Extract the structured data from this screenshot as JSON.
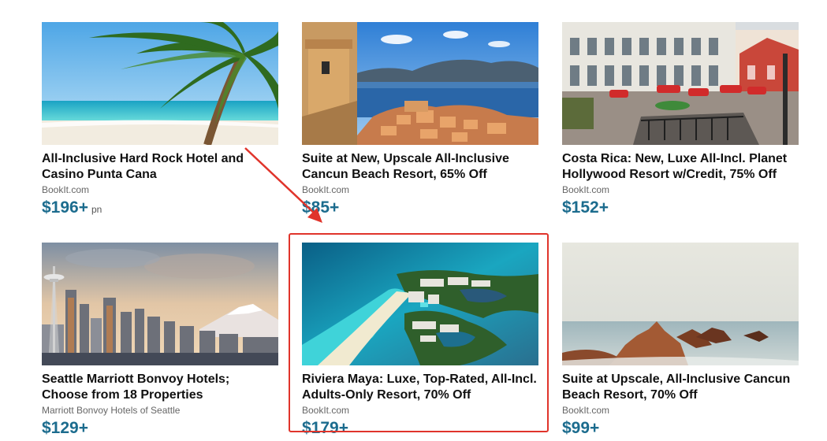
{
  "cards": [
    {
      "title": "All-Inclusive Hard Rock Hotel and Casino Punta Cana",
      "source": "BookIt.com",
      "price": "$196+",
      "unit": "pn",
      "image": "palm-tree-beach"
    },
    {
      "title": "Suite at New, Upscale All-Inclusive Cancun Beach Resort, 65% Off",
      "source": "BookIt.com",
      "price": "$85+",
      "unit": "",
      "image": "coastal-fortress-town"
    },
    {
      "title": "Costa Rica: New, Luxe All-Incl. Planet Hollywood Resort w/Credit, 75% Off",
      "source": "BookIt.com",
      "price": "$152+",
      "unit": "",
      "image": "colonial-plaza"
    },
    {
      "title": "Seattle Marriott Bonvoy Hotels; Choose from 18 Properties",
      "source": "Marriott Bonvoy Hotels of Seattle",
      "price": "$129+",
      "unit": "",
      "image": "seattle-skyline"
    },
    {
      "title": "Riviera Maya: Luxe, Top-Rated, All-Incl. Adults-Only Resort, 70% Off",
      "source": "BookIt.com",
      "price": "$179+",
      "unit": "",
      "image": "aerial-resort-lagoon"
    },
    {
      "title": "Suite at Upscale, All-Inclusive Cancun Beach Resort, 70% Off",
      "source": "BookIt.com",
      "price": "$99+",
      "unit": "",
      "image": "rocky-coast"
    }
  ],
  "annotation": {
    "color": "#e0342b",
    "highlighted_card": "Riviera Maya: Luxe, Top-Rated, All-Incl. Adults-Only Resort, 70% Off"
  },
  "colors": {
    "price": "#1c6c8e",
    "title": "#111111",
    "source": "#666666"
  }
}
